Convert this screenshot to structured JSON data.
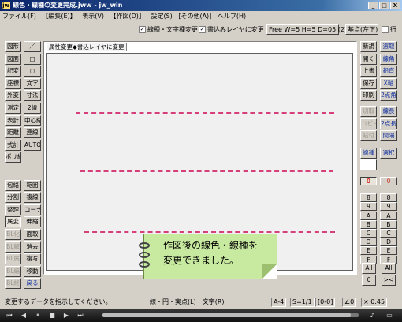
{
  "window": {
    "title": "線色・線種の変更完成.jww - jw_win",
    "app_icon": "jw",
    "btn_min": "_",
    "btn_max": "□",
    "btn_close": "X"
  },
  "menu": [
    "ファイル(F)",
    "【編集(E)】",
    "表示(V)",
    "【作図(D)】",
    "設定(S)",
    "[その他(A)]",
    "ヘルプ(H)"
  ],
  "toolbar": {
    "chk1": "線種・文字種変更",
    "chk2": "書込みレイヤに変更",
    "free": "Free W=5 H=5 D=05 (2)",
    "kiten": "基点(左下)",
    "hen": "行"
  },
  "left_buttons": [
    {
      "l": "図形",
      "r": "／"
    },
    {
      "l": "図面",
      "r": "□"
    },
    {
      "l": "記変",
      "r": "○"
    },
    {
      "l": "座標",
      "r": "文字"
    },
    {
      "l": "外変",
      "r": "寸法"
    },
    {
      "l": "測定",
      "r": "2線"
    },
    {
      "l": "表計",
      "r": "中心線"
    },
    {
      "l": "距離",
      "r": "連線"
    },
    {
      "l": "式計",
      "r": "AUTO"
    },
    {
      "l": "ポリ線",
      "r": ""
    },
    {
      "l": "",
      "r": ""
    },
    {
      "l": "包絡",
      "r": "範囲"
    },
    {
      "l": "分割",
      "r": "複線"
    },
    {
      "l": "整理",
      "r": "コーナー"
    },
    {
      "l": "属変",
      "r": "伸縮"
    },
    {
      "l": "BL化",
      "r": "面取"
    },
    {
      "l": "BL解",
      "r": "消去"
    },
    {
      "l": "BL属",
      "r": "複写"
    },
    {
      "l": "BL編",
      "r": "移動"
    },
    {
      "l": "BL終",
      "r": "戻る"
    }
  ],
  "right_buttons": [
    {
      "l": "新規",
      "r": "選取"
    },
    {
      "l": "開く",
      "r": "線角"
    },
    {
      "l": "上書",
      "r": "鉛直"
    },
    {
      "l": "保存",
      "r": "X軸"
    },
    {
      "l": "印刷",
      "r": "2点角"
    },
    {
      "l": "切取",
      "r": "線長"
    },
    {
      "l": "コピー",
      "r": "2点長"
    },
    {
      "l": "貼付",
      "r": "間隔"
    },
    {
      "l": "線種",
      "r": "選択"
    }
  ],
  "layer_rows": [
    [
      "0",
      "0"
    ],
    [
      "1",
      "1"
    ],
    [
      "2",
      "2"
    ],
    [
      "3",
      "3"
    ],
    [
      "4",
      "4"
    ],
    [
      "5",
      "5"
    ],
    [
      "6",
      "6"
    ],
    [
      "7",
      "7"
    ]
  ],
  "layer_letters": [
    "0",
    "8",
    "9",
    "A",
    "B",
    "C",
    "D",
    "E",
    "F"
  ],
  "layer_tail": {
    "all1": "All",
    "all2": "All",
    "zero": "0",
    "chev": "><"
  },
  "canvas": {
    "tag": "属性変更◆書込レイヤに変更"
  },
  "note": {
    "line1": "作図後の線色・線種を",
    "line2": "変更できました。"
  },
  "status": {
    "msg": "変更するデータを指示してください。",
    "hint": "線・円・実点(L)　文字(R)",
    "scale": "A-4",
    "ratio": "S=1/1",
    "layer": "[0-0]",
    "angle": "∠0",
    "zoom": "× 0.45"
  },
  "player": {
    "icons": [
      "prev-icon",
      "rewind-icon",
      "pause-icon",
      "stop-icon",
      "forward-icon",
      "next-icon"
    ],
    "progress": 0.97
  },
  "colors": {
    "titlebar": "#0a246a",
    "accent_line": "#d6407a",
    "note_bg": "#c8eaa0",
    "active_red": "#d03020"
  }
}
